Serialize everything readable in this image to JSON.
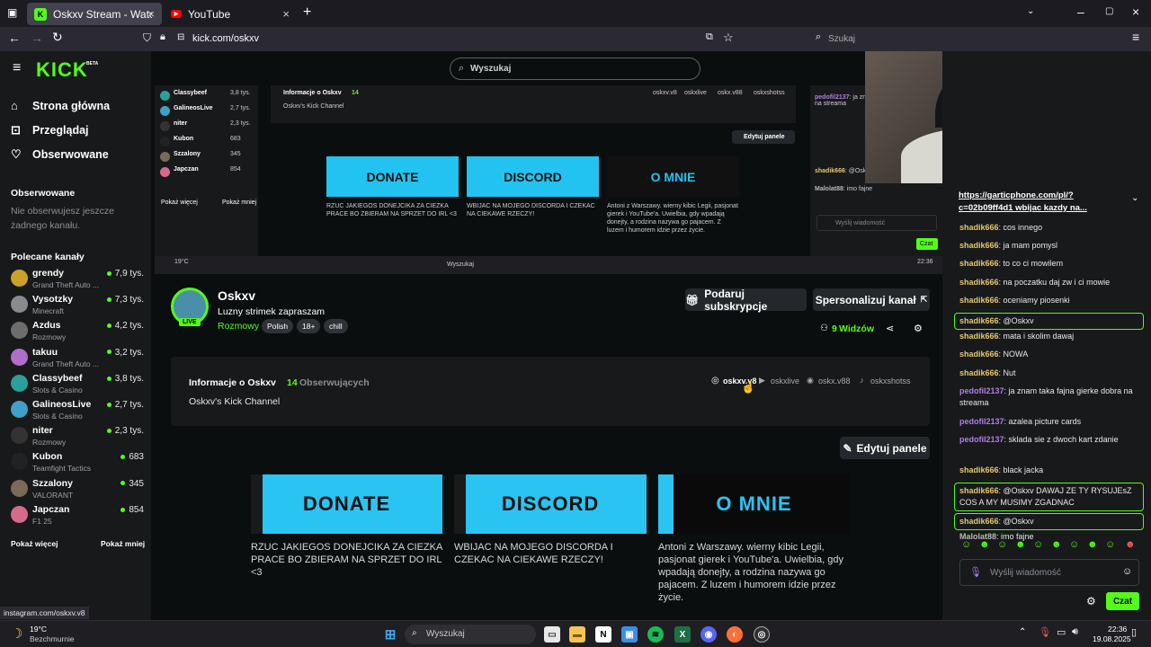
{
  "browser": {
    "tabs": [
      {
        "title": "Oskxv Stream - Watch Live on K",
        "active": true
      },
      {
        "title": "YouTube",
        "active": false
      }
    ],
    "url": "kick.com/oskxv",
    "search_placeholder": "Szukaj",
    "status_url": "instagram.com/oskxv.v8"
  },
  "kick": {
    "logo": "KICK",
    "logo_badge": "BETA",
    "search_placeholder": "Wyszukaj",
    "nav": [
      "Strona główna",
      "Przeglądaj",
      "Obserwowane"
    ],
    "followed_heading": "Obserwowane",
    "followed_empty": "Nie obserwujesz jeszcze żadnego kanału.",
    "recommended_heading": "Polecane kanały",
    "channels": [
      {
        "name": "grendy",
        "category": "Grand Theft Auto ...",
        "viewers": "7,9 tys.",
        "color": "#c9a227"
      },
      {
        "name": "Vysotzky",
        "category": "Minecraft",
        "viewers": "7,3 tys.",
        "color": "#8a8a8a"
      },
      {
        "name": "Azdus",
        "category": "Rozmowy",
        "viewers": "4,2 tys.",
        "color": "#6d6d6d"
      },
      {
        "name": "takuu",
        "category": "Grand Theft Auto ...",
        "viewers": "3,2 tys.",
        "color": "#b06ec9"
      },
      {
        "name": "Classybeef",
        "category": "Slots & Casino",
        "viewers": "3,8 tys.",
        "color": "#2aa198"
      },
      {
        "name": "GalineosLive",
        "category": "Slots & Casino",
        "viewers": "2,7 tys.",
        "color": "#3fa0c9"
      },
      {
        "name": "niter",
        "category": "Rozmowy",
        "viewers": "2,3 tys.",
        "color": "#333333"
      },
      {
        "name": "Kubon",
        "category": "Teamfight Tactics",
        "viewers": "683",
        "color": "#222222"
      },
      {
        "name": "Szzalony",
        "category": "VALORANT",
        "viewers": "345",
        "color": "#7a6a5a"
      },
      {
        "name": "Japczan",
        "category": "F1 25",
        "viewers": "854",
        "color": "#d66a8a"
      }
    ],
    "show_more": "Pokaż więcej",
    "show_less": "Pokaż mniej",
    "channel": {
      "name": "Oskxv",
      "title": "Luzny strimek zapraszam",
      "live_badge": "LIVE",
      "category": "Rozmowy",
      "tags": [
        "Polish",
        "18+",
        "chill"
      ],
      "gift_button": "Podaruj subskrypcje",
      "customize_button": "Spersonalizuj kanał",
      "viewers_count": "9",
      "viewers_label": "Widzów",
      "about_title": "Informacje o Oskxv",
      "followers_count": "14",
      "followers_label": "Obserwujących",
      "about_text": "Oskxv's Kick Channel",
      "socials": [
        "oskxv.v8",
        "oskxlive",
        "oskx.v88",
        "oskxshotss"
      ],
      "edit_panels": "Edytuj panele",
      "panels": [
        {
          "image_text": "DONATE",
          "text": "RZUC JAKIEGOS DONEJCIKA ZA CIEZKA PRACE BO ZBIERAM NA SPRZET DO IRL <3"
        },
        {
          "image_text": "DISCORD",
          "text": "WBIJAC NA MOJEGO DISCORDA I CZEKAC NA CIEKAWE RZECZY!"
        },
        {
          "image_text": "O MNIE",
          "text": "Antoni z Warszawy. wierny kibic Legii, pasjonat gierek i YouTube'a. Uwielbia, gdy wpadają donejty, a rodzina nazywa go pajacem. Z luzem i humorem idzie przez życie."
        }
      ]
    },
    "chat": {
      "pinned": "https://garticphone.com/pl/?c=02b09ff4d1 wbijac kazdy na...",
      "messages": [
        {
          "user": "shadik666",
          "text": "cos innego",
          "color": "#e6c86e",
          "hl": false
        },
        {
          "user": "shadik666",
          "text": "ja mam pomysl",
          "color": "#e6c86e",
          "hl": false
        },
        {
          "user": "shadik666",
          "text": "to co ci mowilem",
          "color": "#e6c86e",
          "hl": false
        },
        {
          "user": "shadik666",
          "text": "na poczatku daj zw i ci mowie",
          "color": "#e6c86e",
          "hl": false
        },
        {
          "user": "shadik666",
          "text": "oceniamy piosenki",
          "color": "#e6c86e",
          "hl": false
        },
        {
          "user": "shadik666",
          "text": "@Oskxv",
          "color": "#e6c86e",
          "hl": true
        },
        {
          "user": "shadik666",
          "text": "mata i skolim dawaj",
          "color": "#e6c86e",
          "hl": false
        },
        {
          "user": "shadik666",
          "text": "NOWA",
          "color": "#e6c86e",
          "hl": false
        },
        {
          "user": "shadik666",
          "text": "Nut",
          "color": "#e6c86e",
          "hl": false
        },
        {
          "user": "pedofil2137",
          "text": "ja znam taka fajna gierke dobra na streama",
          "color": "#b07ee6",
          "hl": false
        },
        {
          "user": "pedofil2137",
          "text": "azalea picture cards",
          "color": "#b07ee6",
          "hl": false
        },
        {
          "user": "pedofil2137",
          "text": "sklada sie z dwoch kart zdanie",
          "color": "#b07ee6",
          "hl": false
        },
        {
          "user": "shadik666",
          "text": "black jacka",
          "color": "#e6c86e",
          "hl": false
        },
        {
          "user": "shadik666",
          "text": "@Oskxv DAWAJ ZE TY RYSUJEsZ COS A MY MUSIMY ZGADNAC",
          "color": "#e6c86e",
          "hl": true
        },
        {
          "user": "shadik666",
          "text": "@Oskxv",
          "color": "#e6c86e",
          "hl": true
        },
        {
          "user": "Malolat88",
          "text": "imo fajne",
          "color": "#b9b9b9",
          "hl": false
        }
      ],
      "input_placeholder": "Wyślij wiadomość",
      "send_button": "Czat"
    }
  },
  "taskbar": {
    "weather_temp": "19°C",
    "weather_desc": "Bezchmurnie",
    "search_placeholder": "Wyszukaj",
    "time": "22:36",
    "date": "19.08.2025"
  },
  "colors": {
    "kick_green": "#53fc18",
    "bg": "#0b0e0f",
    "panel": "#18191b"
  }
}
